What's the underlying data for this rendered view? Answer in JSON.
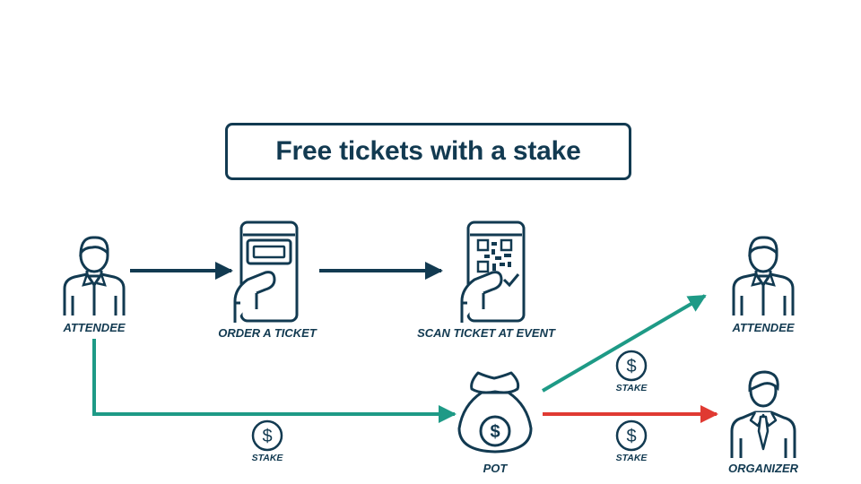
{
  "title": "Free tickets with a stake",
  "nodes": {
    "attendee_start": "ATTENDEE",
    "order_ticket": "ORDER A TICKET",
    "scan_ticket": "SCAN TICKET AT EVENT",
    "pot": "POT",
    "attendee_end": "ATTENDEE",
    "organizer": "ORGANIZER"
  },
  "stakes": {
    "to_pot": "STAKE",
    "to_attendee": "STAKE",
    "to_organizer": "STAKE"
  },
  "icons": {
    "coin": "$",
    "pot_coin": "$"
  },
  "colors": {
    "navy": "#123a51",
    "teal": "#1e9a86",
    "red": "#e03a32"
  }
}
